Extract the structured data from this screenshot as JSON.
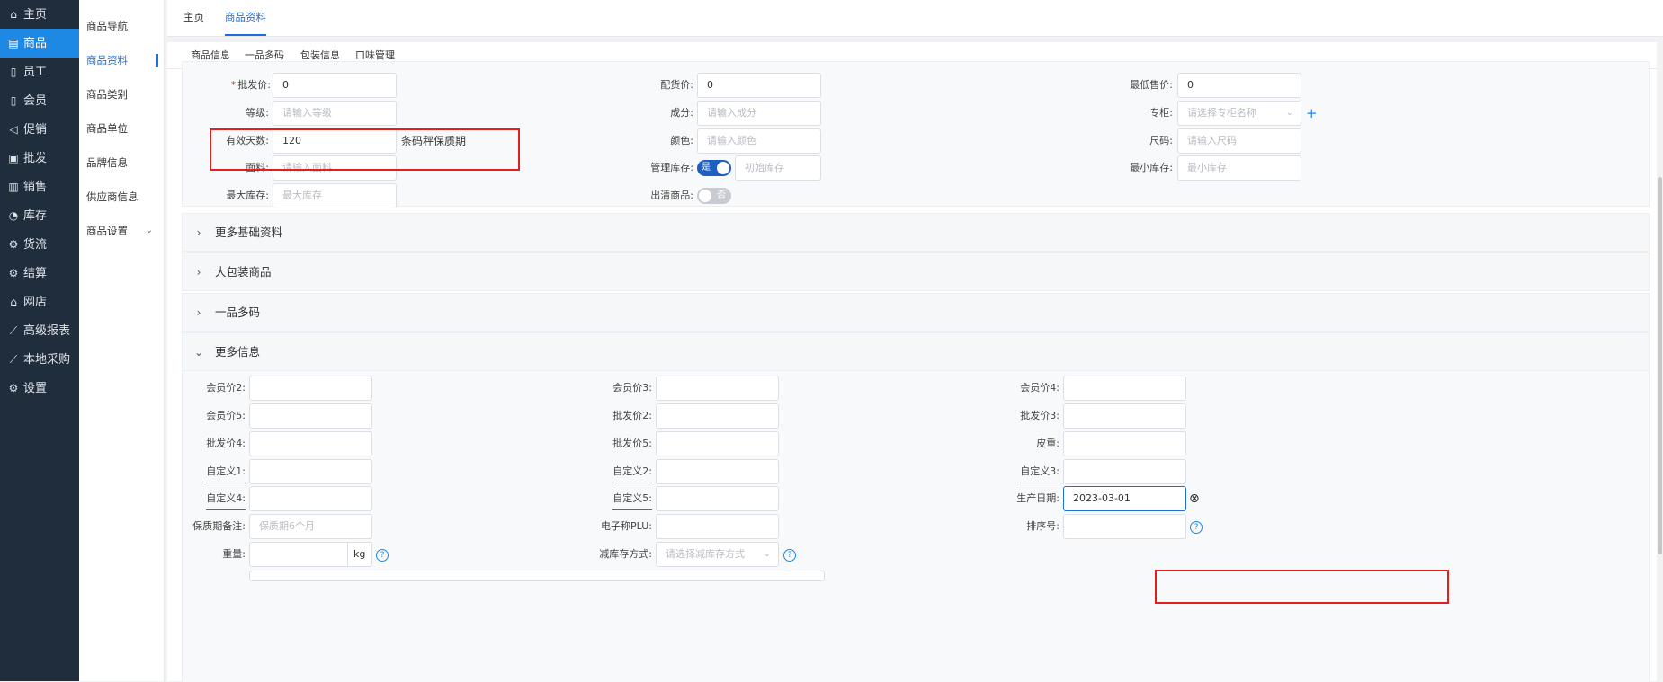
{
  "nav": [
    {
      "icon": "home-icon",
      "glyph": "⌂",
      "label": "主页"
    },
    {
      "icon": "goods-icon",
      "glyph": "▤",
      "label": "商品",
      "active": true
    },
    {
      "icon": "staff-icon",
      "glyph": "▯",
      "label": "员工"
    },
    {
      "icon": "member-icon",
      "glyph": "▯",
      "label": "会员"
    },
    {
      "icon": "promo-icon",
      "glyph": "◁",
      "label": "促销"
    },
    {
      "icon": "wholesale-icon",
      "glyph": "▣",
      "label": "批发"
    },
    {
      "icon": "sales-icon",
      "glyph": "▥",
      "label": "销售"
    },
    {
      "icon": "stock-icon",
      "glyph": "◔",
      "label": "库存"
    },
    {
      "icon": "logistics-icon",
      "glyph": "⚙",
      "label": "货流"
    },
    {
      "icon": "settle-icon",
      "glyph": "⚙",
      "label": "结算"
    },
    {
      "icon": "shop-icon",
      "glyph": "⌂",
      "label": "网店"
    },
    {
      "icon": "report-icon",
      "glyph": "⟋",
      "label": "高级报表"
    },
    {
      "icon": "purchase-icon",
      "glyph": "⟋",
      "label": "本地采购"
    },
    {
      "icon": "settings-icon",
      "glyph": "⚙",
      "label": "设置"
    }
  ],
  "subnav": [
    {
      "label": "商品导航"
    },
    {
      "label": "商品资料",
      "active": true
    },
    {
      "label": "商品类别"
    },
    {
      "label": "商品单位"
    },
    {
      "label": "品牌信息"
    },
    {
      "label": "供应商信息"
    },
    {
      "label": "商品设置",
      "chevron": "⌄"
    }
  ],
  "toptabs": {
    "home": "主页",
    "goods": "商品资料"
  },
  "subtabs": {
    "info": "商品信息",
    "multicode": "一品多码",
    "package": "包装信息",
    "flavor": "口味管理"
  },
  "form": {
    "wholesale_price": {
      "label": "批发价:",
      "value": "0"
    },
    "delivery_price": {
      "label": "配货价:",
      "value": "0"
    },
    "min_price": {
      "label": "最低售价:",
      "value": "0"
    },
    "grade": {
      "label": "等级:",
      "placeholder": "请输入等级"
    },
    "ingredient": {
      "label": "成分:",
      "placeholder": "请输入成分"
    },
    "counter": {
      "label": "专柜:",
      "placeholder": "请选择专柜名称",
      "arrow": "⌄",
      "add": "+"
    },
    "valid_days": {
      "label": "有效天数:",
      "value": "120",
      "note": "条码秤保质期"
    },
    "color": {
      "label": "颜色:",
      "placeholder": "请输入颜色"
    },
    "size": {
      "label": "尺码:",
      "placeholder": "请输入尺码"
    },
    "fabric": {
      "label": "面料:",
      "placeholder": "请输入面料"
    },
    "manage_stock": {
      "label": "管理库存:",
      "toggle": "是",
      "placeholder": "初始库存"
    },
    "min_stock": {
      "label": "最小库存:",
      "placeholder": "最小库存"
    },
    "max_stock": {
      "label": "最大库存:",
      "placeholder": "最大库存"
    },
    "clearance": {
      "label": "出清商品:",
      "toggle": "否"
    }
  },
  "sections": {
    "more_basic": "更多基础资料",
    "big_pack": "大包装商品",
    "multi_code": "一品多码",
    "more_info": "更多信息",
    "collapsed": "›",
    "expanded": "⌄"
  },
  "more": {
    "member2": "会员价2:",
    "member3": "会员价3:",
    "member4": "会员价4:",
    "member5": "会员价5:",
    "wholesale2": "批发价2:",
    "wholesale3": "批发价3:",
    "wholesale4": "批发价4:",
    "wholesale5": "批发价5:",
    "tare": "皮重:",
    "custom1": "自定义1:",
    "custom2": "自定义2:",
    "custom3": "自定义3:",
    "custom4": "自定义4:",
    "custom5": "自定义5:",
    "prod_date": {
      "label": "生产日期:",
      "value": "2023-03-01",
      "clear": "⊗"
    },
    "shelf_note": {
      "label": "保质期备注:",
      "placeholder": "保质期6个月"
    },
    "plu": "电子称PLU:",
    "sort": "排序号:",
    "weight": {
      "label": "重量:",
      "unit": "kg"
    },
    "reduce": {
      "label": "减库存方式:",
      "placeholder": "请选择减库存方式",
      "arrow": "⌄"
    },
    "help": "?"
  }
}
